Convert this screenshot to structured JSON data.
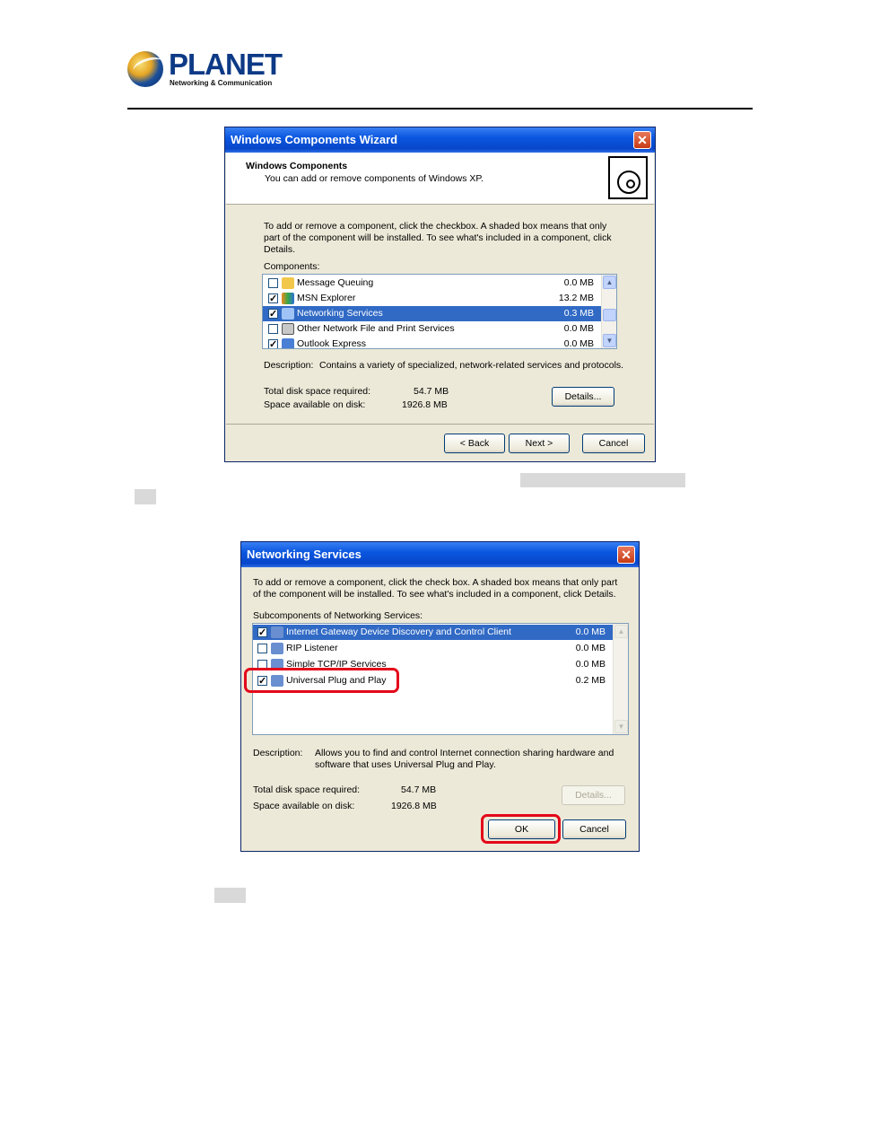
{
  "header": {
    "brand": "PLANET",
    "tagline": "Networking & Communication"
  },
  "wizard": {
    "title": "Windows Components Wizard",
    "heading": "Windows Components",
    "subheading": "You can add or remove components of Windows XP.",
    "instruction_1": "To add or remove a component, click the checkbox.  A shaded box means that only",
    "instruction_2": "part of the component will be installed.  To see what's included in a component, click",
    "instruction_3": "Details.",
    "components_label": "Components:",
    "components": [
      {
        "name": "Message Queuing",
        "size": "0.0 MB",
        "checked": false
      },
      {
        "name": "MSN Explorer",
        "size": "13.2 MB",
        "checked": true
      },
      {
        "name": "Networking Services",
        "size": "0.3 MB",
        "checked": true
      },
      {
        "name": "Other Network File and Print Services",
        "size": "0.0 MB",
        "checked": false
      },
      {
        "name": "Outlook Express",
        "size": "0.0 MB",
        "checked": true
      }
    ],
    "description_label": "Description:",
    "description": "Contains a variety of specialized, network-related services and protocols.",
    "disk_required_label": "Total disk space required:",
    "disk_required": "54.7 MB",
    "disk_available_label": "Space available on disk:",
    "disk_available": "1926.8 MB",
    "details_button": "Details...",
    "back_button": "< Back",
    "next_button": "Next >",
    "cancel_button": "Cancel"
  },
  "networking": {
    "title": "Networking Services",
    "instruction_1": "To add or remove a component, click the check box. A shaded box means that only part",
    "instruction_2": "of the component will be installed. To see what's included in a component, click Details.",
    "subcomponents_label": "Subcomponents of Networking Services:",
    "subcomponents": [
      {
        "name": "Internet Gateway Device Discovery and Control Client",
        "size": "0.0 MB",
        "checked": true
      },
      {
        "name": "RIP Listener",
        "size": "0.0 MB",
        "checked": false
      },
      {
        "name": "Simple TCP/IP Services",
        "size": "0.0 MB",
        "checked": false
      },
      {
        "name": "Universal Plug and Play",
        "size": "0.2 MB",
        "checked": true
      }
    ],
    "description_label": "Description:",
    "description_1": "Allows you to find and control Internet connection sharing hardware and",
    "description_2": "software that uses Universal Plug and Play.",
    "disk_required_label": "Total disk space required:",
    "disk_required": "54.7 MB",
    "disk_available_label": "Space available on disk:",
    "disk_available": "1926.8 MB",
    "details_button": "Details...",
    "ok_button": "OK",
    "cancel_button": "Cancel"
  },
  "colors": {
    "highlight_box": "#e3081a",
    "selection": "#316ac5",
    "titlebar": "#0a57e0",
    "dialog_bg": "#ece9d8"
  }
}
